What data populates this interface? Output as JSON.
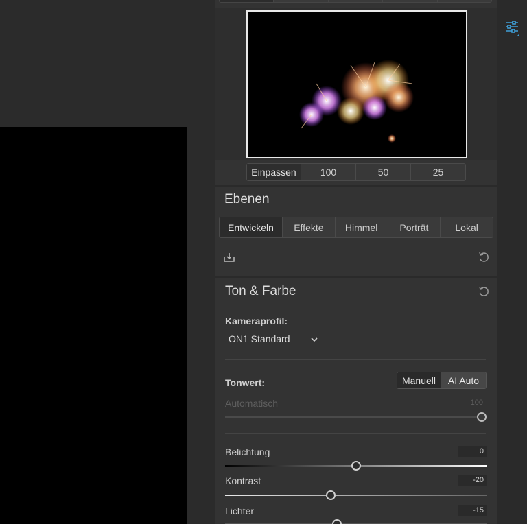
{
  "navigator": {
    "zoom_options": [
      "Einpassen",
      "100",
      "50",
      "25"
    ]
  },
  "layers": {
    "title": "Ebenen",
    "tabs": [
      "Entwickeln",
      "Effekte",
      "Himmel",
      "Porträt",
      "Lokal"
    ]
  },
  "tone_color": {
    "title": "Ton & Farbe",
    "camera_profile_label": "Kameraprofil:",
    "camera_profile_value": "ON1 Standard",
    "tonwert_label": "Tonwert:",
    "mode_manual": "Manuell",
    "mode_ai_auto": "AI Auto",
    "auto_label": "Automatisch",
    "auto_value": "100",
    "auto_level": 1.0,
    "belichtung_label": "Belichtung",
    "belichtung_value": "0",
    "belichtung_level": 0.5,
    "kontrast_label": "Kontrast",
    "kontrast_value": "-20",
    "kontrast_level": 0.4,
    "lichter_label": "Lichter",
    "lichter_value": "-15",
    "lichter_level": 0.425
  },
  "colors": {
    "accent": "#3f9fd8",
    "panel_bg": "#333333",
    "background": "#2b2b2b"
  },
  "icons": [
    "adjustments-icon",
    "export-icon",
    "reset-icon"
  ]
}
